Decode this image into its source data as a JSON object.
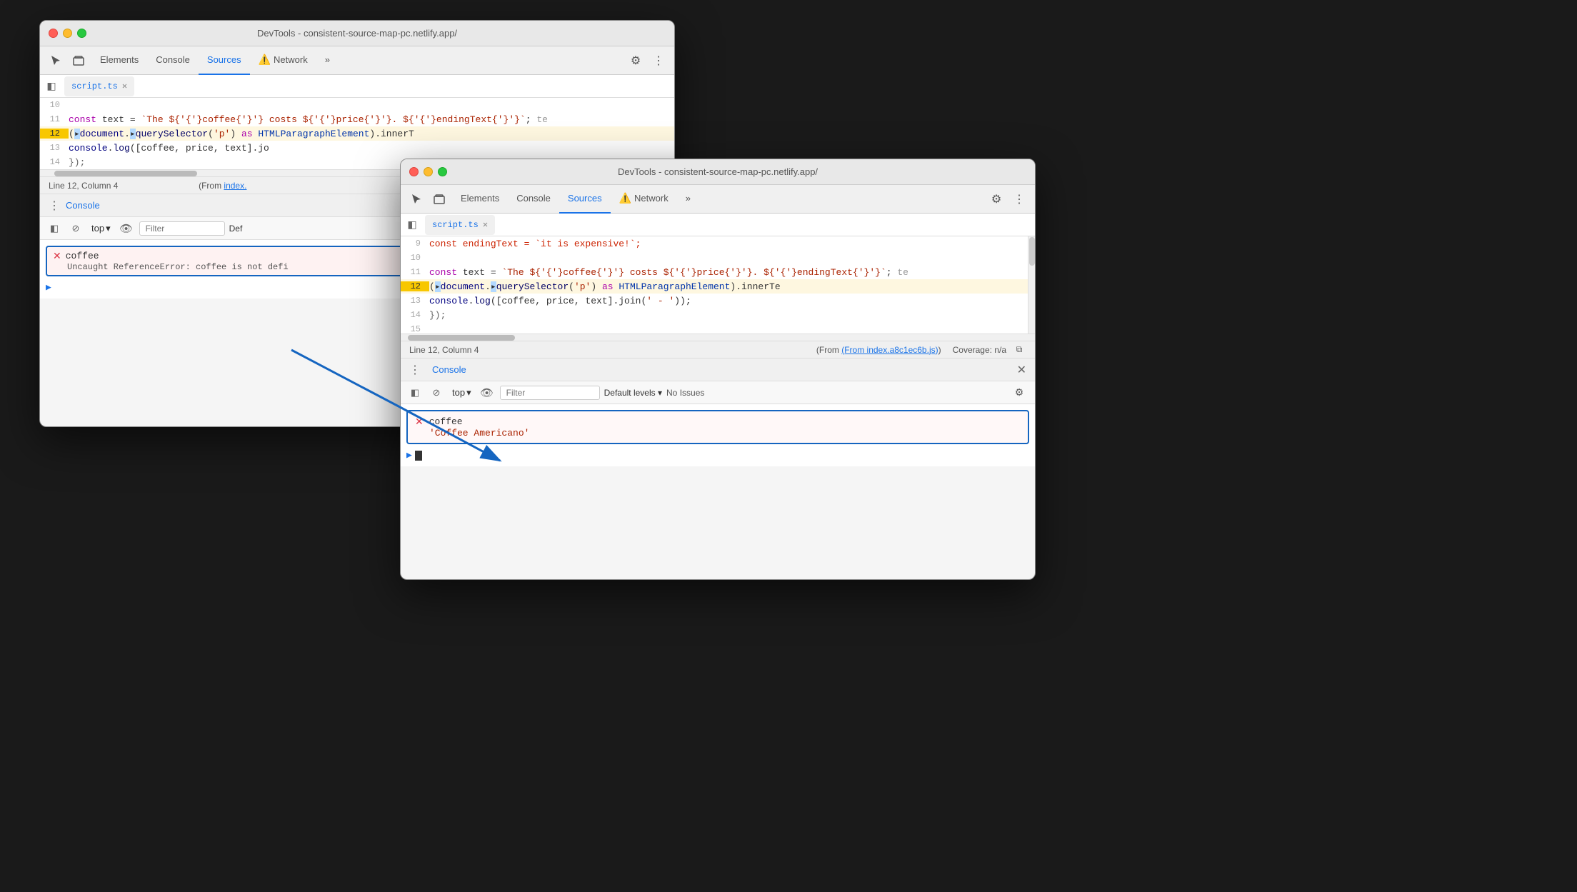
{
  "background": "#1a1a1a",
  "window_back": {
    "title": "DevTools - consistent-source-map-pc.netlify.app/",
    "tabs": [
      "Elements",
      "Console",
      "Sources",
      "Network"
    ],
    "active_tab": "Sources",
    "file_tab": "script.ts",
    "lines": [
      {
        "num": "10",
        "content": "",
        "highlighted": false
      },
      {
        "num": "11",
        "content": "  const text = `The ${coffee} costs ${price}. ${endingText}`;  t",
        "highlighted": false
      },
      {
        "num": "12",
        "content": "  (▸document.▸querySelector('p') as HTMLParagraphElement).innerT",
        "highlighted": true
      },
      {
        "num": "13",
        "content": "  console.log([coffee, price, text].jo",
        "highlighted": false
      },
      {
        "num": "14",
        "content": "  });",
        "highlighted": false
      }
    ],
    "status": "Line 12, Column 4",
    "status_from": "(From index.",
    "console_label": "Console",
    "top_label": "top",
    "filter_placeholder": "Filter",
    "def_levels": "Def",
    "error": {
      "name": "coffee",
      "msg": "Uncaught ReferenceError: coffee is not defi"
    }
  },
  "window_front": {
    "title": "DevTools - consistent-source-map-pc.netlify.app/",
    "tabs": [
      "Elements",
      "Console",
      "Sources",
      "Network"
    ],
    "active_tab": "Sources",
    "file_tab": "script.ts",
    "lines": [
      {
        "num": "9",
        "content": "  const endingText = `it is expensive!`;",
        "highlighted": false,
        "color": "red"
      },
      {
        "num": "10",
        "content": "",
        "highlighted": false
      },
      {
        "num": "11",
        "content": "  const text = `The ${coffee} costs ${price}. ${endingText}`;  te",
        "highlighted": false
      },
      {
        "num": "12",
        "content": "  (▸document.▸querySelector('p') as HTMLParagraphElement).innerTe",
        "highlighted": true
      },
      {
        "num": "13",
        "content": "    console.log([coffee, price, text].join(' - '));",
        "highlighted": false
      },
      {
        "num": "14",
        "content": "  });",
        "highlighted": false
      },
      {
        "num": "15",
        "content": "",
        "highlighted": false
      }
    ],
    "status": "Line 12, Column 4",
    "status_from": "(From index.a8c1ec6b.js)",
    "coverage": "Coverage: n/a",
    "console_label": "Console",
    "top_label": "top",
    "filter_placeholder": "Filter",
    "default_levels": "Default levels",
    "no_issues": "No Issues",
    "error": {
      "name": "coffee",
      "value": "'Coffee Americano'"
    }
  },
  "icons": {
    "elements": "⬜",
    "cursor": "↖",
    "layers": "⧉",
    "gear": "⚙",
    "dots": "⋮",
    "close": "✕",
    "circle_slash": "⊘",
    "eye": "👁",
    "chevron": "▾",
    "arrow_right": "▶",
    "sidebar": "◧"
  }
}
